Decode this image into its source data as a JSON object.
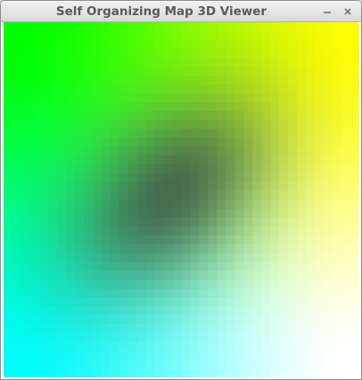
{
  "window": {
    "title": "Self Organizing Map 3D Viewer",
    "minimize_icon": "minimize-icon",
    "close_icon": "close-icon"
  },
  "som_map": {
    "grid_size": 40,
    "corner_colors": {
      "top_left": "#00ff00",
      "top_right": "#ffff00",
      "bottom_left": "#00ffff",
      "bottom_right": "#ffffff"
    },
    "center_color": "#3d4a45"
  }
}
